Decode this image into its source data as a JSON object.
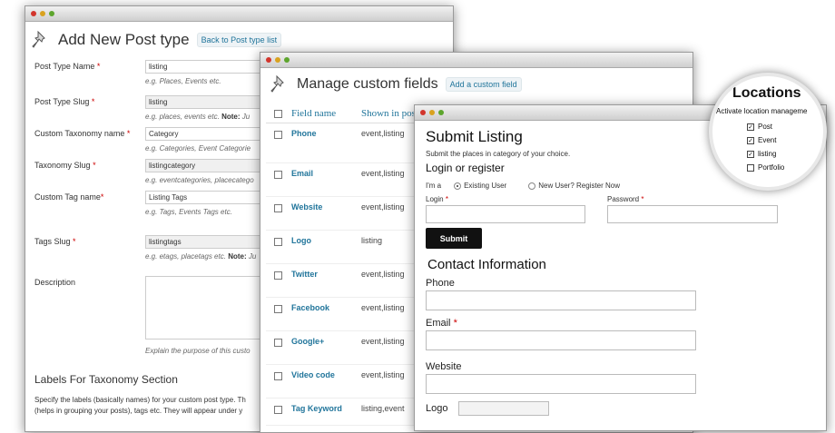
{
  "post_type": {
    "title": "Add New Post type",
    "back_button": "Back to Post type list",
    "fields": [
      {
        "label": "Post Type Name",
        "required": true,
        "value": "listing",
        "hint": "e.g. Places, Events etc.",
        "hint_bold": "",
        "hint_rest": ""
      },
      {
        "label": "Post Type Slug",
        "required": true,
        "value": "listing",
        "hint": "e.g. places, events etc.",
        "hint_bold": "Note:",
        "hint_rest": "Ju"
      },
      {
        "label": "Custom Taxonomy name",
        "required": true,
        "value": "Category",
        "hint": "e.g. Categories, Event Categorie",
        "hint_bold": "",
        "hint_rest": ""
      },
      {
        "label": "Taxonomy Slug",
        "required": true,
        "value": "listingcategory",
        "hint": "e.g. eventcategories, placecatego",
        "hint_bold": "",
        "hint_rest": ""
      },
      {
        "label": "Custom Tag name",
        "required": true,
        "value": "Listing Tags",
        "hint": "e.g. Tags, Events Tags etc.",
        "hint_bold": "",
        "hint_rest": ""
      },
      {
        "label": "Tags Slug",
        "required": true,
        "value": "listingtags",
        "hint": "e.g. etags, placetags etc.",
        "hint_bold": "Note:",
        "hint_rest": "Ju"
      }
    ],
    "description_label": "Description",
    "description_hint": "Explain the purpose of this custo",
    "section_title": "Labels For Taxonomy Section",
    "section_text_1": "Specify the labels (basically names) for your custom post type. Th",
    "section_text_2": "(helps in grouping your posts), tags etc. They will appear under y"
  },
  "custom_fields": {
    "title": "Manage custom fields",
    "add_button": "Add a custom field",
    "col_name": "Field name",
    "col_shown": "Shown in pos",
    "rows": [
      {
        "name": "Phone",
        "shown": "event,listing"
      },
      {
        "name": "Email",
        "shown": "event,listing"
      },
      {
        "name": "Website",
        "shown": "event,listing"
      },
      {
        "name": "Logo",
        "shown": "listing"
      },
      {
        "name": "Twitter",
        "shown": "event,listing"
      },
      {
        "name": "Facebook",
        "shown": "event,listing"
      },
      {
        "name": "Google+",
        "shown": "event,listing"
      },
      {
        "name": "Video code",
        "shown": "event,listing"
      },
      {
        "name": "Tag Keyword",
        "shown": "listing,event"
      }
    ]
  },
  "submit_listing": {
    "title": "Submit Listing",
    "subtitle": "Submit the places in category of your choice.",
    "login_heading": "Login or register",
    "im_a": "I'm a",
    "radio_existing": "Existing User",
    "radio_new": "New User? Register Now",
    "login_label": "Login",
    "password_label": "Password",
    "submit_button": "Submit",
    "contact_heading": "Contact Information",
    "phone_label": "Phone",
    "email_label": "Email",
    "website_label": "Website",
    "logo_label": "Logo"
  },
  "locations": {
    "title": "Locations",
    "subtitle": "Activate location manageme",
    "items": [
      {
        "label": "Post",
        "checked": true
      },
      {
        "label": "Event",
        "checked": true
      },
      {
        "label": "listing",
        "checked": true
      },
      {
        "label": "Portfolio",
        "checked": false
      }
    ]
  }
}
